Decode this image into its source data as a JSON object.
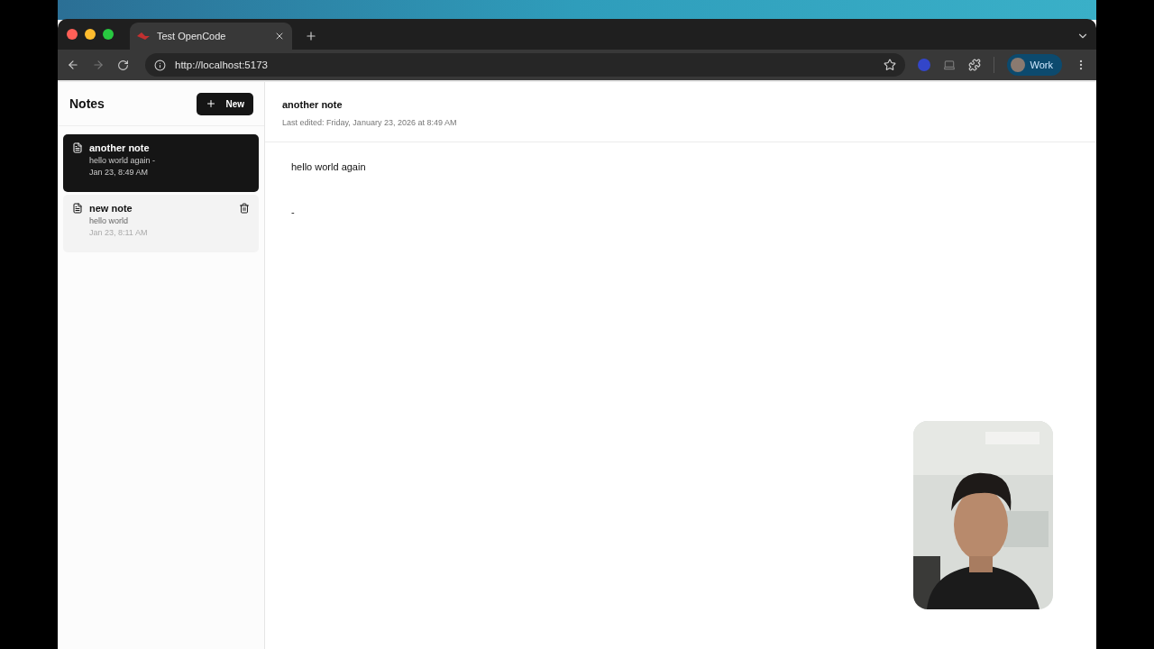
{
  "browser": {
    "tab_title": "Test OpenCode",
    "url": "http://localhost:5173",
    "profile": "Work"
  },
  "sidebar": {
    "title": "Notes",
    "new_button": "New",
    "notes": [
      {
        "title": "another note",
        "preview": "hello world again -",
        "date": "Jan 23, 8:49 AM",
        "selected": true,
        "hovered": false
      },
      {
        "title": "new note",
        "preview": "hello world",
        "date": "Jan 23, 8:11 AM",
        "selected": false,
        "hovered": true
      }
    ]
  },
  "editor": {
    "title": "another note",
    "last_edited": "Last edited: Friday, January 23, 2026 at 8:49 AM",
    "lines": [
      "hello world again",
      "-"
    ]
  }
}
